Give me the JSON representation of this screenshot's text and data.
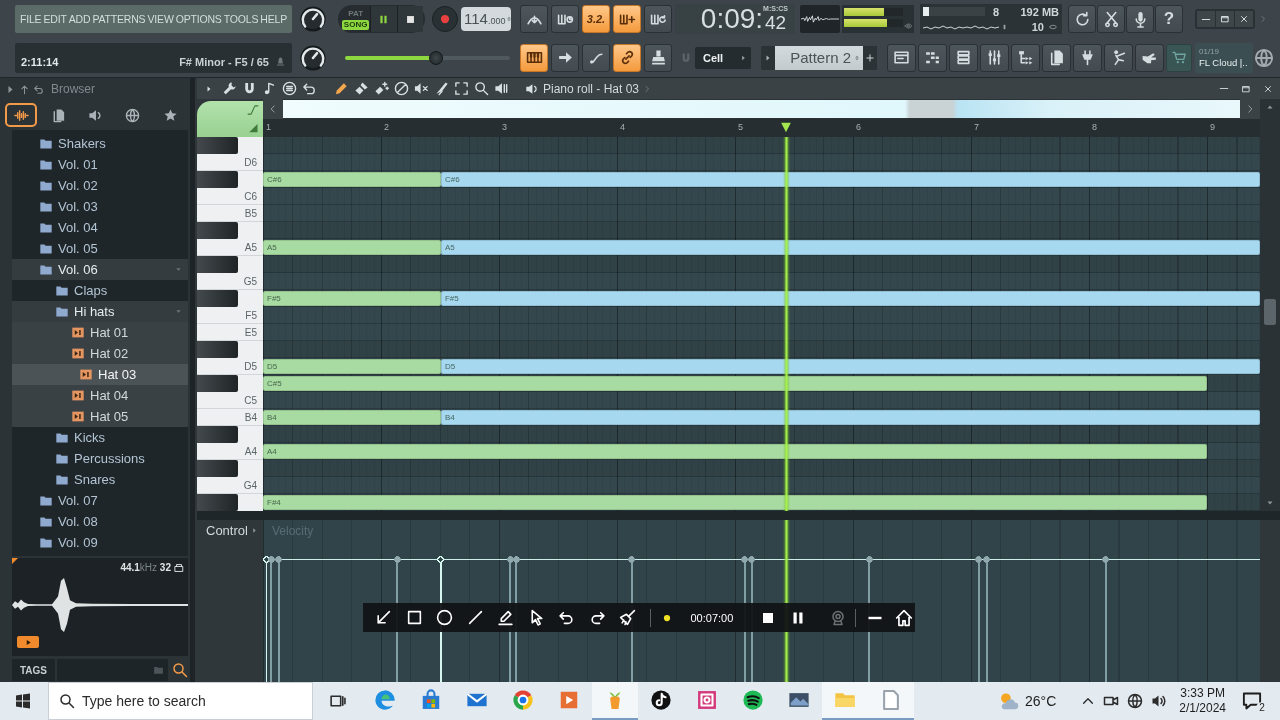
{
  "menu": [
    "FILE",
    "EDIT",
    "ADD",
    "PATTERNS",
    "VIEW",
    "OPTIONS",
    "TOOLS",
    "HELP"
  ],
  "hint_bar": {
    "time": "2:11:14",
    "text": "F# Minor - F5 / 65"
  },
  "transport": {
    "modes": [
      {
        "label": "PAT",
        "selected": false
      },
      {
        "label": "SONG",
        "selected": true
      }
    ],
    "playing": true,
    "tempo": "114",
    "tempo_decimals": ".000",
    "volume": {
      "level": 0.55
    }
  },
  "toolbar_top": [
    {
      "on": false
    },
    {
      "on": false
    },
    {
      "label": "3.2.",
      "on": true
    },
    {
      "on": true
    },
    {
      "on": false
    }
  ],
  "clock": {
    "time": "0:09:",
    "centiseconds": "42",
    "format": "M:S:CS"
  },
  "meters": [
    {
      "level": 0.68
    },
    {
      "level": 0.73
    }
  ],
  "monitor": {
    "cpu": {
      "level": 0.1
    },
    "readings": [
      "8",
      "192 MB",
      "10"
    ]
  },
  "help": "?",
  "toolbar_bottom": [
    {
      "on": true
    },
    {
      "on": false
    },
    {
      "on": false
    },
    {
      "on": true
    },
    {
      "on": false
    }
  ],
  "snap": "Cell",
  "pattern": "Pattern 2",
  "cloud": {
    "counter": "01/19",
    "label": "FL Cloud |.."
  },
  "browser": {
    "title": "Browser",
    "tabs": [
      {
        "selected": true
      },
      {
        "selected": false
      },
      {
        "selected": false
      },
      {
        "selected": false
      },
      {
        "selected": false
      }
    ],
    "tree": [
      {
        "label": "Shakers",
        "kind": "folder",
        "expanded": false,
        "selected": false
      },
      {
        "label": "Vol. 01",
        "kind": "folder",
        "expanded": false,
        "selected": false
      },
      {
        "label": "Vol. 02",
        "kind": "folder",
        "expanded": false,
        "selected": false
      },
      {
        "label": "Vol. 03",
        "kind": "folder",
        "expanded": false,
        "selected": false
      },
      {
        "label": "Vol. 04",
        "kind": "folder",
        "expanded": false,
        "selected": false
      },
      {
        "label": "Vol. 05",
        "kind": "folder",
        "expanded": false,
        "selected": false
      },
      {
        "label": "Vol. 06",
        "kind": "folder",
        "expanded": true,
        "selected": false,
        "children": [
          {
            "label": "Claps",
            "kind": "folder",
            "expanded": false,
            "selected": false
          },
          {
            "label": "Hi hats",
            "kind": "folder",
            "expanded": true,
            "selected": false,
            "children": [
              {
                "label": "Hat 01",
                "kind": "sample",
                "selected": false
              },
              {
                "label": "Hat 02",
                "kind": "sample",
                "selected": false
              },
              {
                "label": "Hat 03",
                "kind": "sample",
                "selected": true
              },
              {
                "label": "Hat 04",
                "kind": "sample",
                "selected": false
              },
              {
                "label": "Hat 05",
                "kind": "sample",
                "selected": false
              }
            ]
          },
          {
            "label": "Kicks",
            "kind": "folder",
            "expanded": false,
            "selected": false
          },
          {
            "label": "Percussions",
            "kind": "folder",
            "expanded": false,
            "selected": false
          },
          {
            "label": "Snares",
            "kind": "folder",
            "expanded": false,
            "selected": false
          }
        ]
      },
      {
        "label": "Vol. 07",
        "kind": "folder",
        "expanded": false,
        "selected": false
      },
      {
        "label": "Vol. 08",
        "kind": "folder",
        "expanded": false,
        "selected": false
      },
      {
        "label": "Vol. 09",
        "kind": "folder",
        "expanded": false,
        "selected": false
      }
    ],
    "preview": {
      "rate": "44.1",
      "unit": "kHz",
      "bits": "32"
    },
    "tags": "TAGS"
  },
  "piano_roll": {
    "title": "Piano roll - Hat 03",
    "tools": [
      {
        "selected": false
      },
      {
        "selected": false
      },
      {
        "selected": false
      },
      {
        "selected": false
      },
      {
        "selected": false
      },
      {
        "selected": true
      },
      {
        "selected": false
      },
      {
        "selected": false
      },
      {
        "selected": false
      },
      {
        "selected": false
      },
      {
        "selected": false
      },
      {
        "selected": false
      },
      {
        "selected": false
      },
      {
        "selected": false
      }
    ],
    "ruler": [
      "1",
      "2",
      "3",
      "4",
      "5",
      "6",
      "7",
      "8",
      "9"
    ],
    "playhead": {
      "level": 0.525
    },
    "keys": [
      {
        "kind": "black"
      },
      {
        "kind": "white",
        "label": "D6"
      },
      {
        "kind": "black",
        "notes": [
          {
            "label": "C#6",
            "level": 0.1785,
            "color": "#a8dba1"
          },
          {
            "label": "C#6",
            "level": 0.8215,
            "color": "#a6d9ef"
          }
        ]
      },
      {
        "kind": "white",
        "label": "C6"
      },
      {
        "kind": "white",
        "label": "B5"
      },
      {
        "kind": "black"
      },
      {
        "kind": "white",
        "label": "A5",
        "notes": [
          {
            "label": "A5",
            "level": 0.1785,
            "color": "#a8dba1"
          },
          {
            "label": "A5",
            "level": 0.8215,
            "color": "#a6d9ef"
          }
        ]
      },
      {
        "kind": "black"
      },
      {
        "kind": "white",
        "label": "G5"
      },
      {
        "kind": "black",
        "notes": [
          {
            "label": "F#5",
            "level": 0.1785,
            "color": "#a8dba1"
          },
          {
            "label": "F#5",
            "level": 0.8215,
            "color": "#a6d9ef"
          }
        ]
      },
      {
        "kind": "white",
        "label": "F5"
      },
      {
        "kind": "white",
        "label": "E5"
      },
      {
        "kind": "black"
      },
      {
        "kind": "white",
        "label": "D5",
        "notes": [
          {
            "label": "D5",
            "level": 0.1785,
            "color": "#a8dba1"
          },
          {
            "label": "D5",
            "level": 0.8215,
            "color": "#a6d9ef"
          }
        ]
      },
      {
        "kind": "black",
        "notes": [
          {
            "label": "C#5",
            "level": 0.947,
            "color": "#a8dba1"
          }
        ]
      },
      {
        "kind": "white",
        "label": "C5"
      },
      {
        "kind": "white",
        "label": "B4",
        "notes": [
          {
            "label": "B4",
            "level": 0.1785,
            "color": "#a8dba1"
          },
          {
            "label": "B4",
            "level": 0.8215,
            "color": "#a6d9ef"
          }
        ]
      },
      {
        "kind": "black"
      },
      {
        "kind": "white",
        "label": "A4",
        "notes": [
          {
            "label": "A4",
            "level": 0.947,
            "color": "#a8dba1"
          }
        ]
      },
      {
        "kind": "black"
      },
      {
        "kind": "white",
        "label": "G4"
      },
      {
        "kind": "black",
        "notes": [
          {
            "label": "F#4",
            "level": 0.947,
            "color": "#a8dba1"
          }
        ]
      }
    ],
    "control": {
      "label": "Control",
      "parameter": "Velocity"
    }
  },
  "recorder": {
    "time": "00:07:00"
  },
  "taskbar": {
    "search": {
      "placeholder": "Type here to search"
    },
    "apps": [
      {
        "active": false
      },
      {
        "active": false
      },
      {
        "active": false
      },
      {
        "active": false
      },
      {
        "active": false
      },
      {
        "active": true
      },
      {
        "active": false
      },
      {
        "active": false
      },
      {
        "active": false
      },
      {
        "active": false
      },
      {
        "active": true
      },
      {
        "active": true
      }
    ],
    "weather": "26°C",
    "time": "3:33 PM",
    "date": "2/1/2024",
    "notifications": "2"
  }
}
